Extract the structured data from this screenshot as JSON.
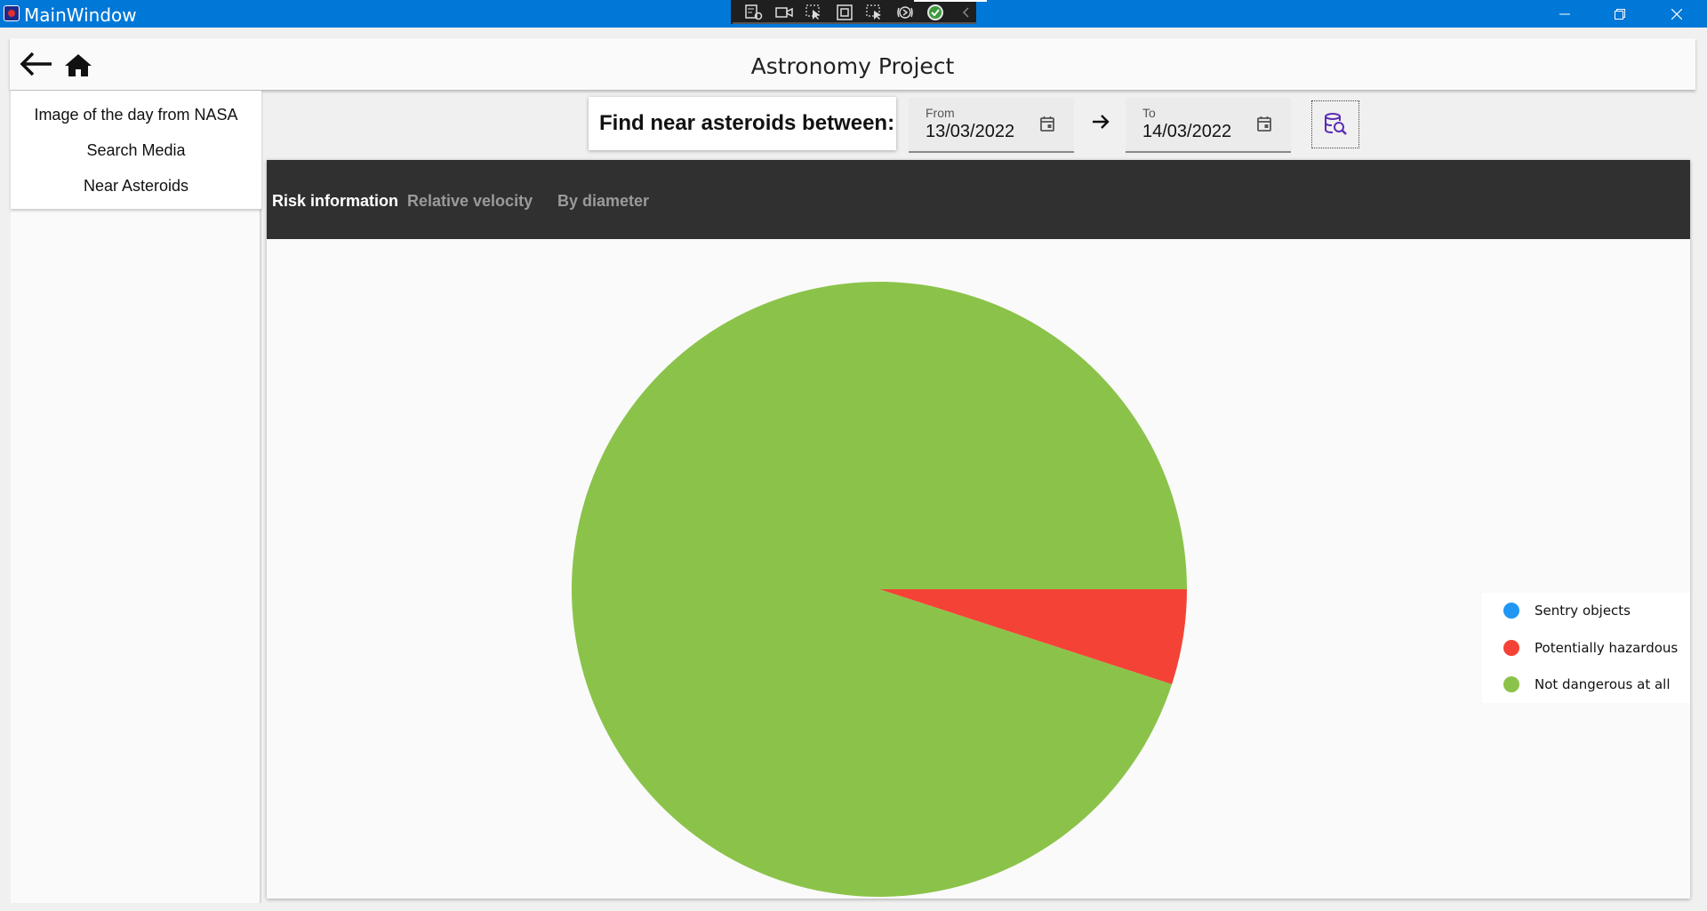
{
  "window": {
    "title": "MainWindow"
  },
  "header": {
    "title": "Astronomy Project"
  },
  "sidebar": {
    "items": [
      {
        "label": "Image of the day from NASA"
      },
      {
        "label": "Search Media"
      },
      {
        "label": "Near Asteroids"
      }
    ]
  },
  "search": {
    "prompt": "Find near asteroids between:",
    "from": {
      "label": "From",
      "value": "13/03/2022"
    },
    "to": {
      "label": "To",
      "value": "14/03/2022"
    }
  },
  "tabs": [
    {
      "label": "Risk information",
      "active": true
    },
    {
      "label": "Relative velocity",
      "active": false
    },
    {
      "label": "By diameter",
      "active": false
    }
  ],
  "colors": {
    "titlebar": "#0078d7",
    "sentry": "#2196f3",
    "hazardous": "#f44336",
    "safe": "#8bc34a",
    "accent_icon": "#5b2bb5"
  },
  "chart_data": {
    "type": "pie",
    "series": [
      {
        "name": "Sentry objects",
        "value": 0,
        "color": "#2196f3"
      },
      {
        "name": "Potentially hazardous",
        "value": 1,
        "color": "#f44336"
      },
      {
        "name": "Not dangerous at all",
        "value": 19,
        "color": "#8bc34a"
      }
    ],
    "legend_position": "right"
  }
}
